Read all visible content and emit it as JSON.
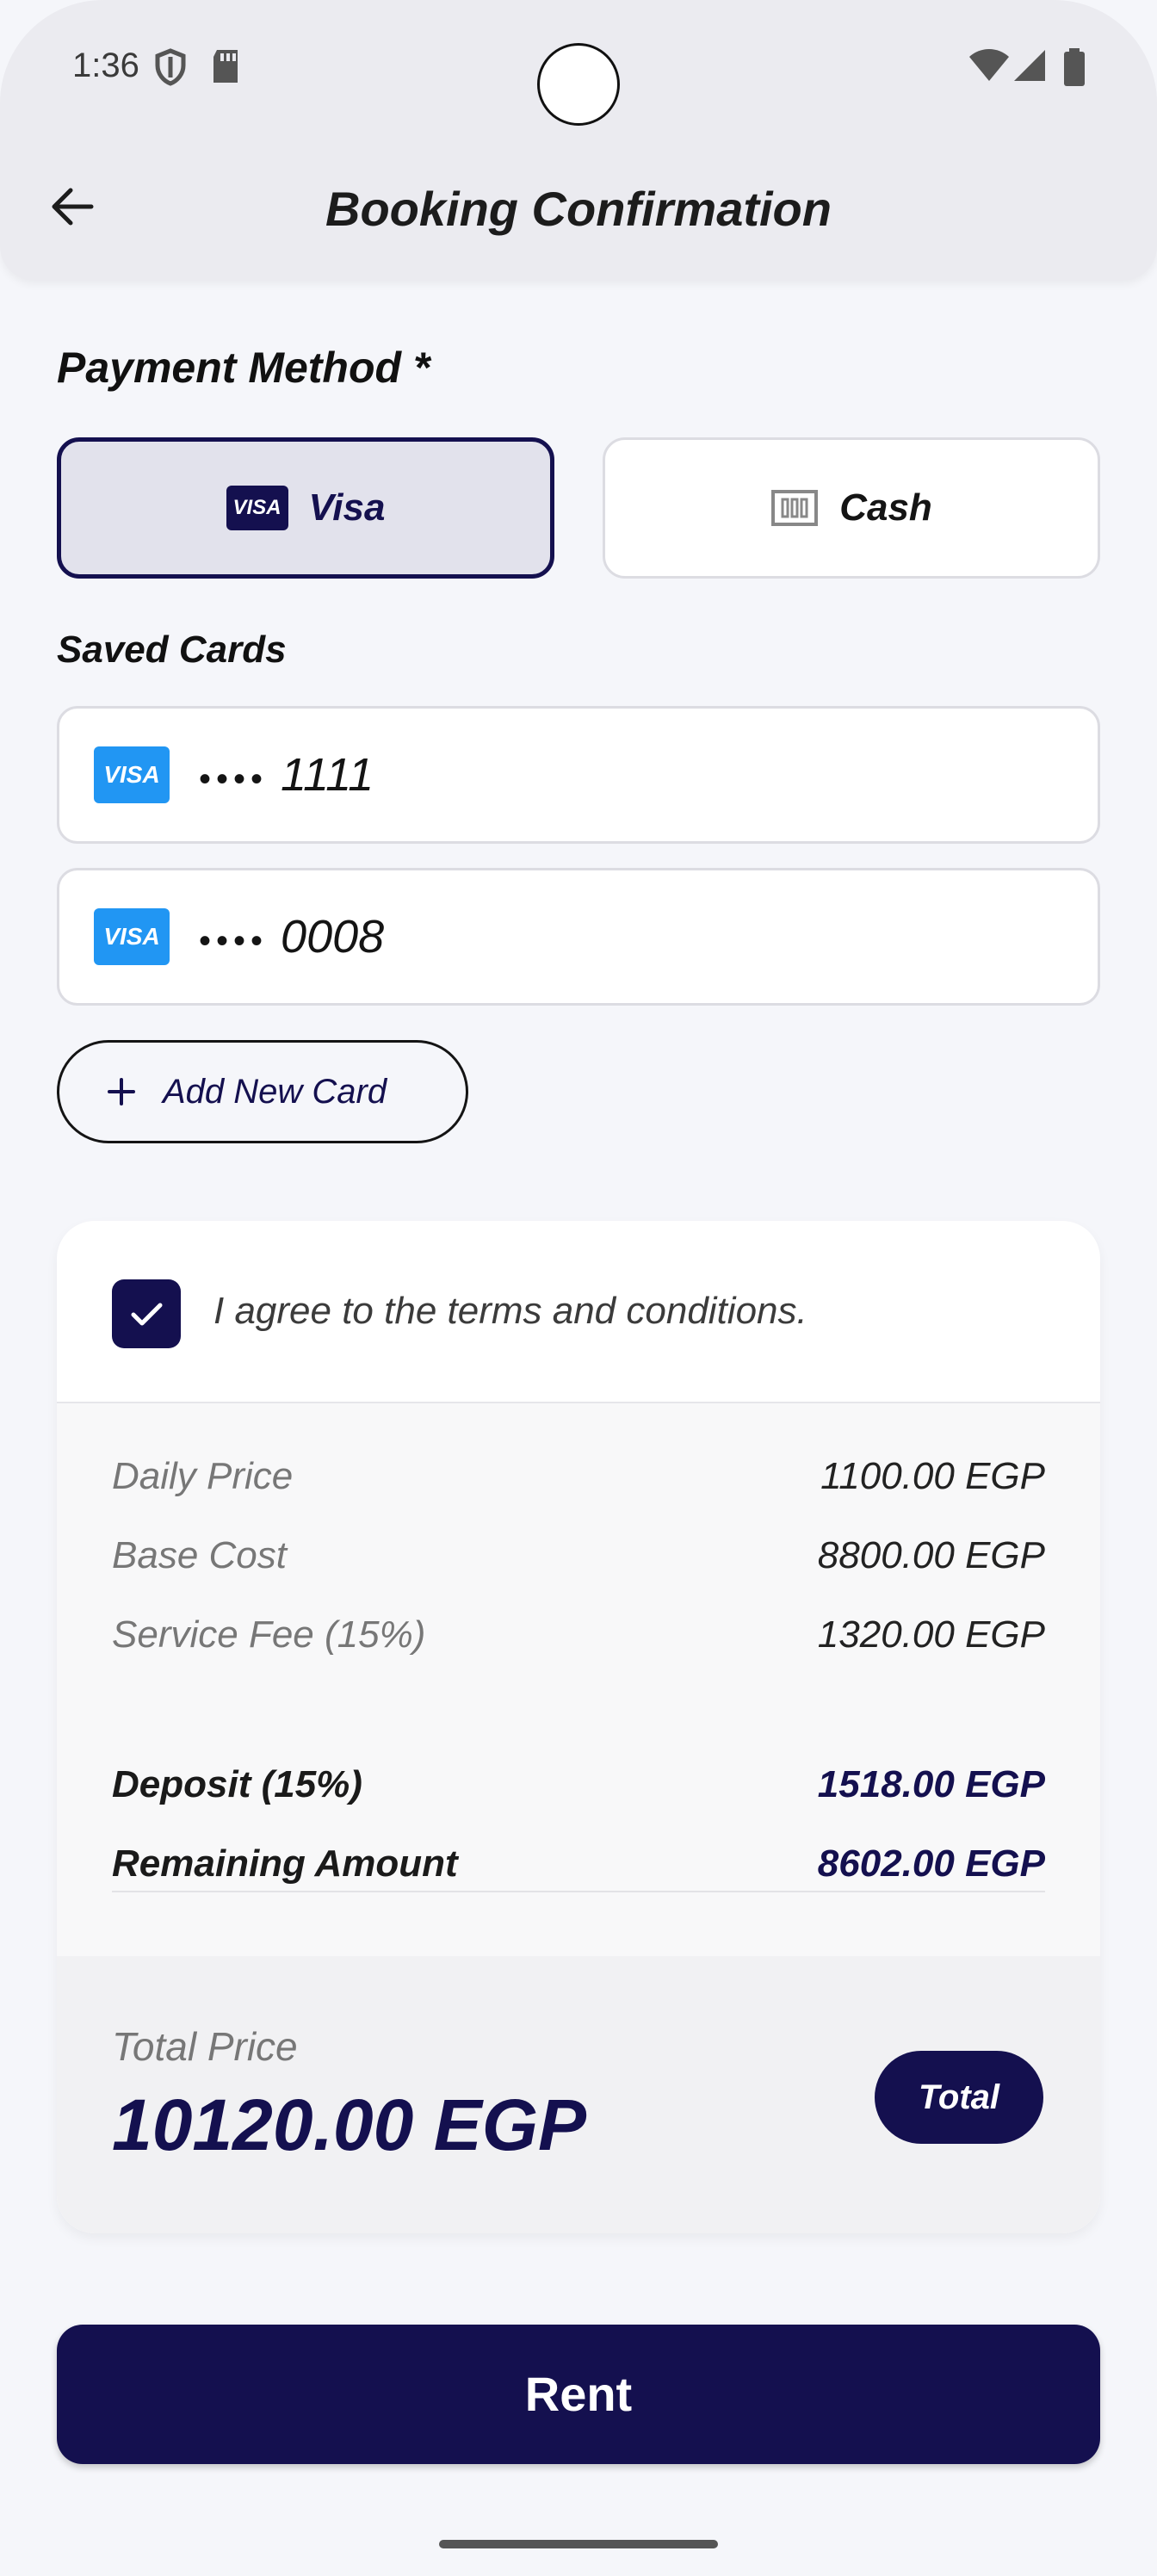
{
  "status_bar": {
    "time": "1:36"
  },
  "header": {
    "title": "Booking Confirmation",
    "back_icon": "arrow-left-icon"
  },
  "payment": {
    "label": "Payment Method *",
    "options": [
      {
        "label": "Visa",
        "selected": true,
        "icon": "visa-icon",
        "badge_text": "VISA"
      },
      {
        "label": "Cash",
        "selected": false,
        "icon": "cash-icon"
      }
    ]
  },
  "saved_cards": {
    "label": "Saved Cards",
    "cards": [
      {
        "brand": "VISA",
        "masked": "••••",
        "last4": "1111"
      },
      {
        "brand": "VISA",
        "masked": "••••",
        "last4": "0008"
      }
    ],
    "add_label": "Add New Card"
  },
  "terms": {
    "text": "I agree to the terms and conditions.",
    "checked": true
  },
  "breakdown": {
    "daily_price": {
      "label": "Daily Price",
      "value": "1100.00 EGP"
    },
    "base_cost": {
      "label": "Base Cost",
      "value": "8800.00 EGP"
    },
    "service_fee": {
      "label": "Service Fee (15%)",
      "value": "1320.00 EGP"
    },
    "deposit": {
      "label": "Deposit (15%)",
      "value": "1518.00 EGP"
    },
    "remaining": {
      "label": "Remaining Amount",
      "value": "8602.00 EGP"
    }
  },
  "total": {
    "label": "Total Price",
    "value": "10120.00 EGP",
    "badge": "Total"
  },
  "actions": {
    "rent_label": "Rent"
  },
  "colors": {
    "primary": "#14104f",
    "visa_blue": "#2196f3",
    "background": "#f5f6fa"
  }
}
